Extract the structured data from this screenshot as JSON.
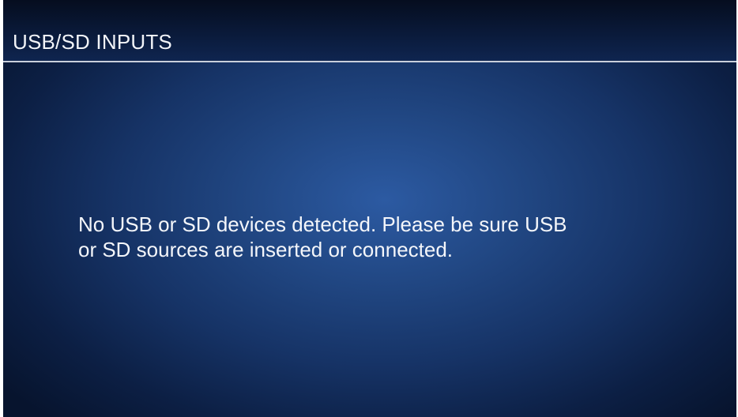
{
  "header": {
    "title": "USB/SD INPUTS"
  },
  "main": {
    "message_line1": "No USB or SD devices detected. Please be sure USB",
    "message_line2": "or SD sources are inserted or connected."
  },
  "colors": {
    "background_center": "#2c5aa2",
    "background_edge": "#07142e",
    "text": "#f4f6fa",
    "divider": "#c9cfdb"
  }
}
